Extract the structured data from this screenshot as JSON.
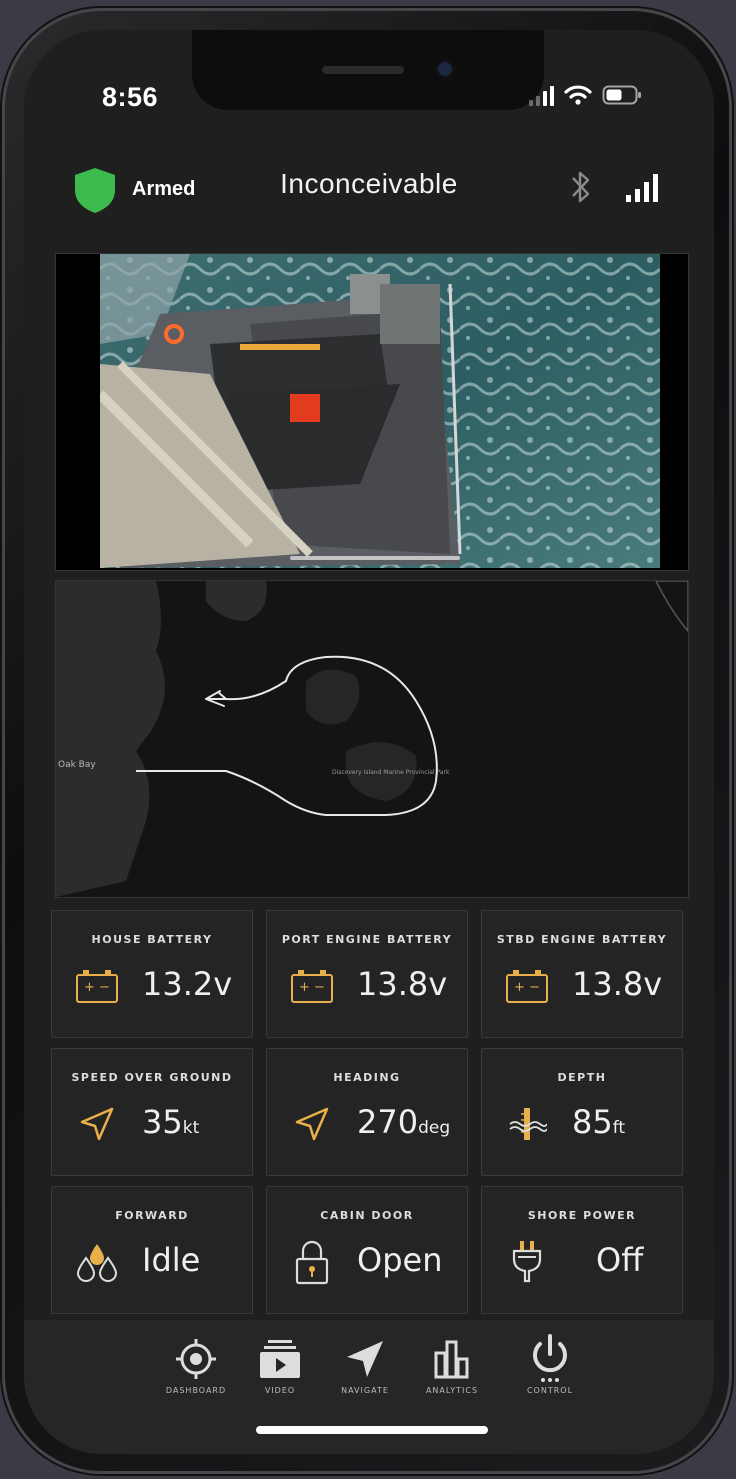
{
  "status_bar": {
    "time": "8:56",
    "icons": [
      "cellular-signal-icon",
      "wifi-icon",
      "battery-icon"
    ]
  },
  "header": {
    "security_status": "Armed",
    "vessel_name": "Inconceivable",
    "icons": [
      "shield-icon",
      "bluetooth-icon",
      "signal-strength-icon"
    ]
  },
  "map": {
    "labels": [
      "Oak Bay",
      "Discovery Island Marine Provincial Park"
    ]
  },
  "tiles": [
    {
      "label": "HOUSE BATTERY",
      "value": "13.2v",
      "unit": "",
      "icon": "battery-icon"
    },
    {
      "label": "PORT ENGINE BATTERY",
      "value": "13.8v",
      "unit": "",
      "icon": "battery-icon"
    },
    {
      "label": "STBD ENGINE BATTERY",
      "value": "13.8v",
      "unit": "",
      "icon": "battery-icon"
    },
    {
      "label": "SPEED OVER GROUND",
      "value": "35",
      "unit": "kt",
      "icon": "navigation-arrow-icon"
    },
    {
      "label": "HEADING",
      "value": "270",
      "unit": "deg",
      "icon": "navigation-arrow-icon"
    },
    {
      "label": "DEPTH",
      "value": "85",
      "unit": "ft",
      "icon": "depth-gauge-icon"
    },
    {
      "label": "FORWARD",
      "value": "Idle",
      "unit": "",
      "icon": "bilge-water-drops-icon"
    },
    {
      "label": "CABIN DOOR",
      "value": "Open",
      "unit": "",
      "icon": "padlock-icon"
    },
    {
      "label": "SHORE POWER",
      "value": "Off",
      "unit": "",
      "icon": "power-plug-icon"
    }
  ],
  "tabbar": {
    "items": [
      {
        "label": "DASHBOARD",
        "icon": "crosshair-icon"
      },
      {
        "label": "VIDEO",
        "icon": "video-icon"
      },
      {
        "label": "NAVIGATE",
        "icon": "navigate-arrow-icon"
      },
      {
        "label": "ANALYTICS",
        "icon": "bar-chart-icon"
      },
      {
        "label": "CONTROL",
        "icon": "power-icon"
      }
    ]
  },
  "colors": {
    "accent": "#e8b04a",
    "shield": "#3dbb4e",
    "background": "#1f1f1f",
    "tile": "#242424"
  }
}
